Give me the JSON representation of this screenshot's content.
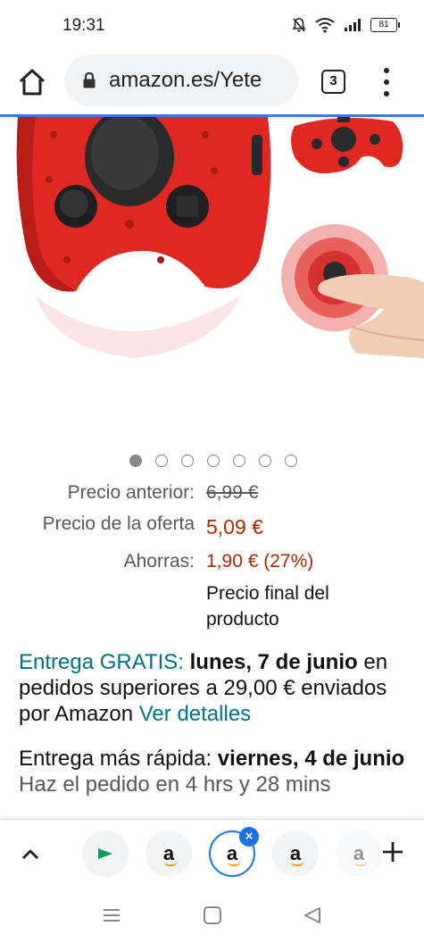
{
  "status_bar": {
    "time": "19:31",
    "battery": "81",
    "icons": [
      "bell-off-icon",
      "wifi-icon",
      "signal-icon",
      "battery-icon"
    ]
  },
  "toolbar": {
    "url": "amazon.es/Yete",
    "tab_count": "3",
    "accent_color": "#3b78e7"
  },
  "carousel": {
    "total": 7,
    "active_index": 0
  },
  "prices": {
    "previous_label": "Precio anterior:",
    "previous_value": "6,99 €",
    "offer_label": "Precio de la oferta",
    "offer_value": "5,09 €",
    "savings_label": "Ahorras:",
    "savings_value": "1,90 € (27%)",
    "final_note": "Precio final del producto",
    "price_color": "#b12704"
  },
  "delivery": {
    "free_label": "Entrega GRATIS:",
    "free_date": "lunes, 7 de junio",
    "free_condition": "en pedidos superiores a 29,00 € enviados por Amazon",
    "details_link": "Ver detalles",
    "fast_label": "Entrega más rápida:",
    "fast_date": "viernes, 4 de junio",
    "order_in": "Haz el pedido en 4 hrs y 28 mins",
    "link_color": "#007185"
  },
  "tab_strip": {
    "amazon_letter": "a",
    "tabs": [
      {
        "type": "play"
      },
      {
        "type": "amazon"
      },
      {
        "type": "amazon",
        "selected": true
      },
      {
        "type": "amazon"
      },
      {
        "type": "amazon",
        "faded": true
      }
    ],
    "close_glyph": "×"
  },
  "nav_bar": {
    "buttons": [
      "menu-icon",
      "home-square-icon",
      "back-triangle-icon"
    ]
  }
}
